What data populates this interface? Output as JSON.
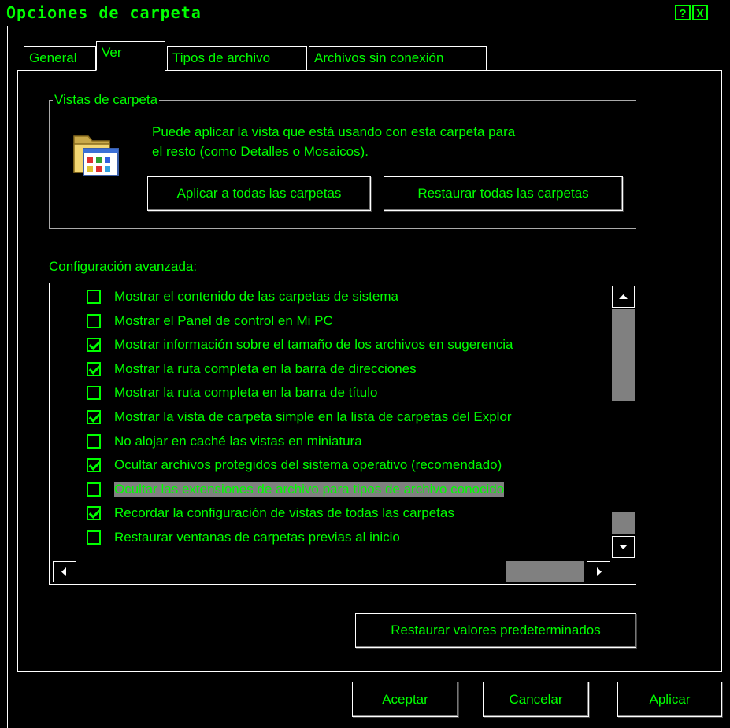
{
  "window": {
    "title": "Opciones de carpeta",
    "help_btn": "?",
    "close_btn": "X"
  },
  "tabs": [
    {
      "label": "General"
    },
    {
      "label": "Ver"
    },
    {
      "label": "Tipos de archivo"
    },
    {
      "label": "Archivos sin conexión"
    }
  ],
  "folder_views": {
    "group_title": "Vistas de carpeta",
    "description_line1": "Puede aplicar la vista que está usando con esta carpeta para",
    "description_line2": "el resto (como Detalles o Mosaicos).",
    "apply_all_btn": "Aplicar a todas las carpetas",
    "restore_all_btn": "Restaurar todas las carpetas",
    "icon": "folder-icon"
  },
  "advanced": {
    "label": "Configuración avanzada:",
    "items": [
      {
        "label": "Mostrar el contenido de las carpetas de sistema",
        "checked": false
      },
      {
        "label": "Mostrar el Panel de control en Mi PC",
        "checked": false
      },
      {
        "label": "Mostrar información sobre el tamaño de los archivos en sugerencia",
        "checked": true
      },
      {
        "label": "Mostrar la ruta completa en la barra de direcciones",
        "checked": true
      },
      {
        "label": "Mostrar la ruta completa en la barra de título",
        "checked": false
      },
      {
        "label": "Mostrar la vista de carpeta simple en la lista de carpetas del Explor",
        "checked": true
      },
      {
        "label": "No alojar en caché las vistas en miniatura",
        "checked": false
      },
      {
        "label": "Ocultar archivos protegidos del sistema operativo (recomendado)",
        "checked": true
      },
      {
        "label": "Ocultar las extensiones de archivo para tipos de archivo conocido",
        "checked": false
      },
      {
        "label": "Recordar la configuración de vistas de todas las carpetas",
        "checked": true
      },
      {
        "label": "Restaurar ventanas de carpetas previas al inicio",
        "checked": false
      }
    ],
    "restore_defaults_btn": "Restaurar valores predeterminados"
  },
  "footer": {
    "ok_btn": "Aceptar",
    "cancel_btn": "Cancelar",
    "apply_btn": "Aplicar"
  },
  "colors": {
    "foreground": "#00ff00",
    "background": "#000000",
    "selection": "#808080"
  }
}
